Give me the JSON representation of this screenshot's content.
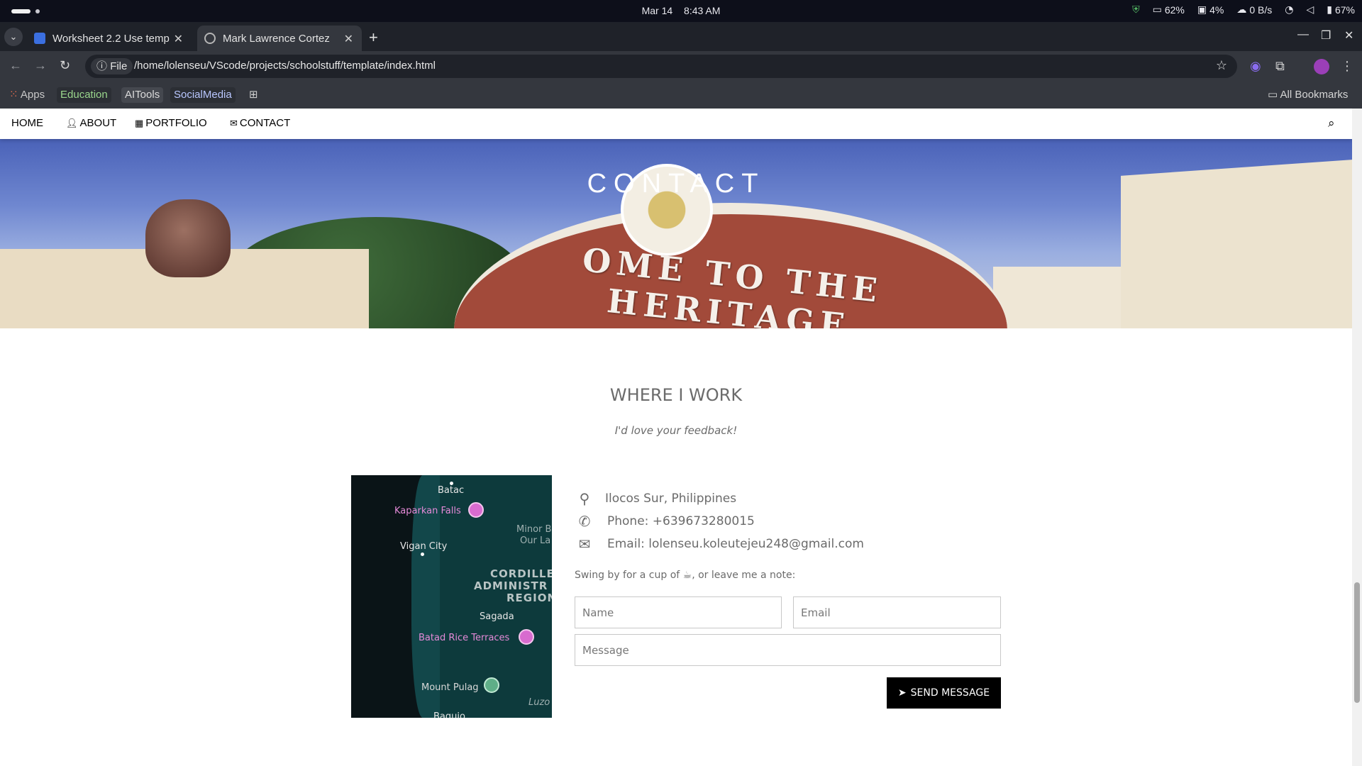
{
  "os": {
    "date": "Mar 14",
    "time": "8:43 AM",
    "cpu": "62%",
    "mem": "4%",
    "net": "0 B/s",
    "battery": "67%"
  },
  "tabs": [
    {
      "title": "Worksheet 2.2 Use temp",
      "icon": "docs-icon"
    },
    {
      "title": "Mark Lawrence Cortez",
      "icon": "globe-icon"
    }
  ],
  "address": {
    "scheme_label": "File",
    "url": "/home/lolenseu/VScode/projects/schoolstuff/template/index.html"
  },
  "bookmarks": {
    "apps": "Apps",
    "items": [
      "Education",
      "AITools",
      "SocialMedia"
    ],
    "all": "All Bookmarks"
  },
  "site_nav": {
    "home": "HOME",
    "about": "ABOUT",
    "portfolio": "PORTFOLIO",
    "contact": "CONTACT"
  },
  "banner": {
    "title": "CONTACT",
    "arch_text": "OME TO THE HERITAGE"
  },
  "section": {
    "title": "WHERE I WORK",
    "subtitle": "I'd love your feedback!"
  },
  "map": {
    "labels": {
      "batac": "Batac",
      "kaparkan": "Kaparkan Falls",
      "minor1": "Minor B",
      "minor2": "Our La",
      "vigan": "Vigan City",
      "cordillera1": "CORDILLE",
      "cordillera2": "ADMINISTR",
      "cordillera3": "REGION",
      "sagada": "Sagada",
      "batad": "Batad Rice Terraces",
      "pulag": "Mount Pulag",
      "luzon": "Luzo",
      "baguio": "Baguio"
    }
  },
  "contact": {
    "location": "Ilocos Sur, Philippines",
    "phone": "Phone: +639673280015",
    "email": "Email: lolenseu.koleutejeu248@gmail.com",
    "note": "Swing by for a cup of ☕, or leave me a note:"
  },
  "form": {
    "name_placeholder": "Name",
    "email_placeholder": "Email",
    "message_placeholder": "Message",
    "send_label": "SEND MESSAGE"
  }
}
